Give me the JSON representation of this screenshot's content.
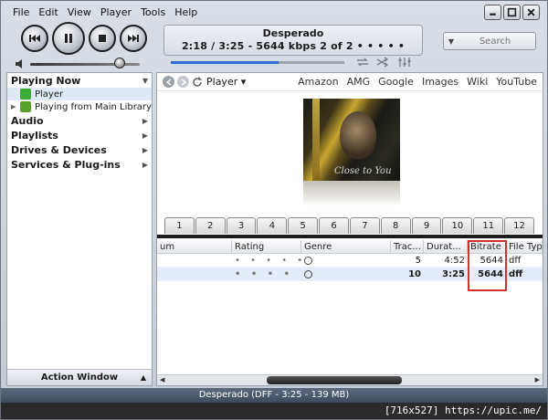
{
  "menu": [
    "File",
    "Edit",
    "View",
    "Player",
    "Tools",
    "Help"
  ],
  "now_playing": {
    "title": "Desperado",
    "info": "2:18 / 3:25 - 5644 kbps   2 of 2  • • • • •",
    "progress": 0.62,
    "volume": 0.82
  },
  "search": {
    "placeholder": "Search"
  },
  "sidebar": {
    "sections": [
      {
        "label": "Playing Now",
        "expanded": true
      },
      {
        "label": "Audio"
      },
      {
        "label": "Playlists"
      },
      {
        "label": "Drives & Devices"
      },
      {
        "label": "Services & Plug-ins"
      }
    ],
    "playing_now_items": [
      {
        "label": "Player",
        "selected": true,
        "icon_color": "#3aaa35"
      },
      {
        "label": "Playing from Main Library",
        "selected": false,
        "icon_color": "#5aa02c"
      }
    ],
    "action_window": "Action Window"
  },
  "toolbar": {
    "player_label": "Player",
    "links": [
      "Amazon",
      "AMG",
      "Google",
      "Images",
      "Wiki",
      "YouTube"
    ]
  },
  "album": {
    "text": "Close to You"
  },
  "tabs": [
    "1",
    "2",
    "3",
    "4",
    "5",
    "6",
    "7",
    "8",
    "9",
    "10",
    "11",
    "12"
  ],
  "table": {
    "headers": [
      "um",
      "Rating",
      "Genre",
      "Trac...",
      "Durat...",
      "Bitrate",
      "File Type"
    ],
    "rows": [
      {
        "rating": "• • • • •",
        "track": "5",
        "duration": "4:52",
        "bitrate": "5644",
        "filetype": "dff",
        "selected": false
      },
      {
        "rating": "• • • • •",
        "track": "10",
        "duration": "3:25",
        "bitrate": "5644",
        "filetype": "dff",
        "selected": true
      }
    ]
  },
  "status": "Desperado (DFF - 3:25 - 139 MB)",
  "watermark": "[716x527] https://upic.me/",
  "colors": {
    "accent": "#2c6fd1",
    "highlight_box": "#d32f2f",
    "status_bg": "#4a566b"
  }
}
